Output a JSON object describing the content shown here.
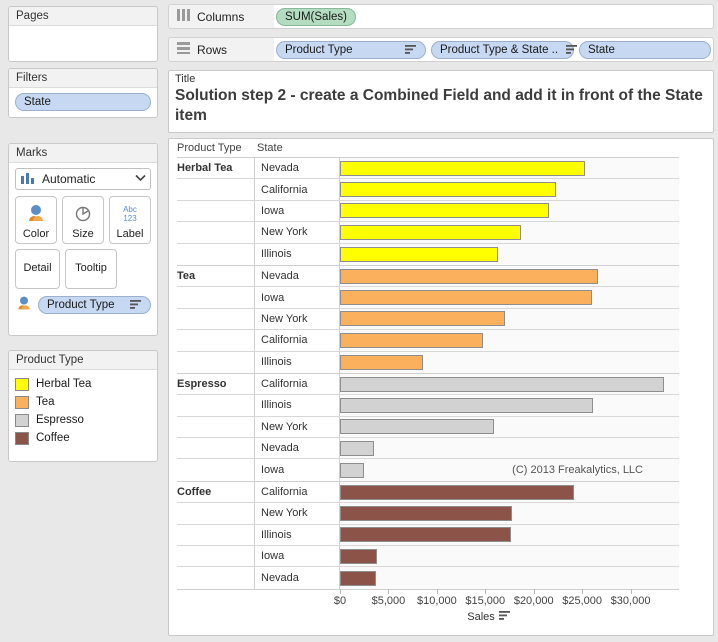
{
  "pages": {
    "title": "Pages"
  },
  "filters": {
    "title": "Filters",
    "items": [
      {
        "label": "State"
      }
    ]
  },
  "marks": {
    "title": "Marks",
    "mark_type": "Automatic",
    "dropdown_icon": "chevron-down-icon",
    "buttons": [
      {
        "label": "Color",
        "icon": "color-icon"
      },
      {
        "label": "Size",
        "icon": "size-icon"
      },
      {
        "label": "Label",
        "icon": "label-icon",
        "glyph_top": "Abc",
        "glyph_bottom": "123"
      }
    ],
    "buttons_row2": [
      {
        "label": "Detail",
        "icon": "detail-icon"
      },
      {
        "label": "Tooltip",
        "icon": "tooltip-icon"
      }
    ],
    "assignments": [
      {
        "label": "Product Type",
        "icon": "color-icon",
        "sort": "sort-icon"
      }
    ]
  },
  "legend": {
    "title": "Product Type",
    "items": [
      {
        "label": "Herbal Tea",
        "color": "#FFFF00"
      },
      {
        "label": "Tea",
        "color": "#FBB05D"
      },
      {
        "label": "Espresso",
        "color": "#D2D2D2"
      },
      {
        "label": "Coffee",
        "color": "#8C5348"
      }
    ]
  },
  "shelves": {
    "columns": {
      "label": "Columns",
      "icon": "columns-icon",
      "pills": [
        {
          "text": "SUM(Sales)",
          "kind": "measure"
        }
      ]
    },
    "rows": {
      "label": "Rows",
      "icon": "rows-icon",
      "pills": [
        {
          "text": "Product Type",
          "kind": "dimension",
          "sort": true
        },
        {
          "text": "Product Type & State ..",
          "kind": "dimension",
          "sort": true
        },
        {
          "text": "State",
          "kind": "dimension",
          "sort": false
        }
      ]
    }
  },
  "title_band": {
    "label": "Title",
    "text": "Solution step 2 - create a Combined Field and add it in front of the State item"
  },
  "viz": {
    "col_header_product_type": "Product Type",
    "col_header_state": "State",
    "copyright": "(C) 2013 Freakalytics, LLC"
  },
  "chart_data": {
    "type": "bar",
    "title": "Solution step 2 - create a Combined Field and add it in front of the State item",
    "orientation": "horizontal",
    "xlabel": "Sales",
    "ylabel": "",
    "xlim": [
      0,
      35000
    ],
    "xticks": [
      0,
      5000,
      10000,
      15000,
      20000,
      25000,
      30000
    ],
    "xticklabels": [
      "$0",
      "$5,000",
      "$10,000",
      "$15,000",
      "$20,000",
      "$25,000",
      "$30,000"
    ],
    "grid": false,
    "legend_position": "left-panel",
    "groups": [
      {
        "name": "Herbal Tea",
        "color": "#FFFF00",
        "categories": [
          "Nevada",
          "California",
          "Iowa",
          "New York",
          "Illinois"
        ],
        "values": [
          25300,
          22300,
          21600,
          18700,
          16300
        ]
      },
      {
        "name": "Tea",
        "color": "#FBB05D",
        "categories": [
          "Nevada",
          "Iowa",
          "New York",
          "California",
          "Illinois"
        ],
        "values": [
          26600,
          26000,
          17000,
          14800,
          8600
        ]
      },
      {
        "name": "Espresso",
        "color": "#D2D2D2",
        "categories": [
          "California",
          "Illinois",
          "New York",
          "Nevada",
          "Iowa"
        ],
        "values": [
          33500,
          26100,
          15900,
          3500,
          2500
        ]
      },
      {
        "name": "Coffee",
        "color": "#8C5348",
        "categories": [
          "California",
          "New York",
          "Illinois",
          "Iowa",
          "Nevada"
        ],
        "values": [
          24200,
          17800,
          17700,
          3800,
          3700
        ]
      }
    ]
  }
}
